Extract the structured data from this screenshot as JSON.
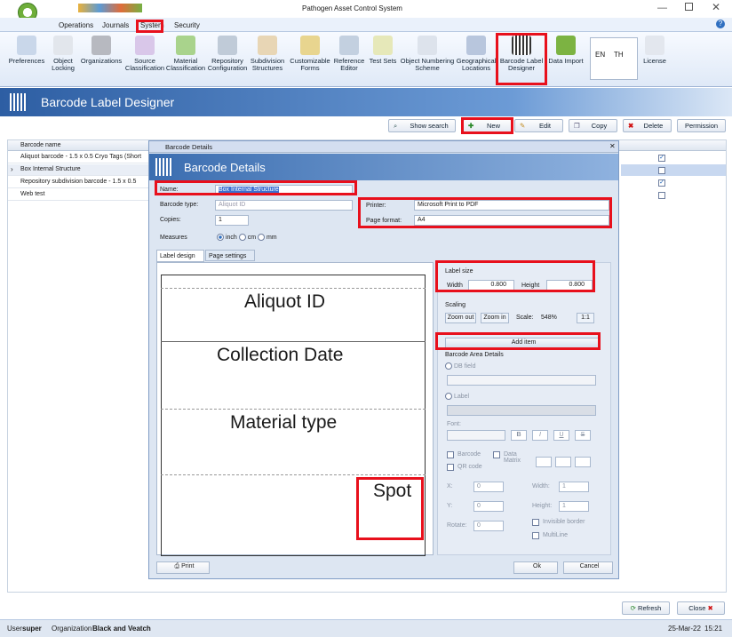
{
  "app": {
    "title": "Pathogen Asset Control System",
    "help": "?"
  },
  "ribbon_tabs": [
    "Operations",
    "Journals",
    "System",
    "Security"
  ],
  "ribbon": [
    {
      "l1": "Preferences",
      "l2": ""
    },
    {
      "l1": "Object",
      "l2": "Locking"
    },
    {
      "l1": "Organizations",
      "l2": ""
    },
    {
      "l1": "Source",
      "l2": "Classification"
    },
    {
      "l1": "Material",
      "l2": "Classification"
    },
    {
      "l1": "Repository",
      "l2": "Configuration"
    },
    {
      "l1": "Subdivision",
      "l2": "Structures"
    },
    {
      "l1": "Customizable",
      "l2": "Forms"
    },
    {
      "l1": "Reference",
      "l2": "Editor"
    },
    {
      "l1": "Test Sets",
      "l2": ""
    },
    {
      "l1": "Object Numbering",
      "l2": "Scheme"
    },
    {
      "l1": "Geographical",
      "l2": "Locations"
    },
    {
      "l1": "Barcode Label",
      "l2": "Designer"
    },
    {
      "l1": "Data Import",
      "l2": ""
    }
  ],
  "lang": {
    "en": "EN",
    "th": "TH"
  },
  "license": "License",
  "header": {
    "title": "Barcode Label Designer"
  },
  "toolbar": {
    "search": "Show search",
    "new": "New",
    "edit": "Edit",
    "copy": "Copy",
    "delete": "Delete",
    "permission": "Permission"
  },
  "list": {
    "header": "Barcode name",
    "rows": [
      {
        "name": "Aliquot barcode - 1.5 x 0.5 Cryo Tags (Short",
        "checked": true
      },
      {
        "name": "Box Internal Structure",
        "checked": false
      },
      {
        "name": "Repository subdivision barcode - 1.5 x 0.5",
        "checked": true
      },
      {
        "name": "Web test",
        "checked": false
      }
    ]
  },
  "dialog": {
    "window_title": "Barcode Details",
    "title": "Barcode Details",
    "name_label": "Name:",
    "name_value": "Box Internal Structure",
    "type_label": "Barcode type:",
    "type_value": "Aliquot ID",
    "copies_label": "Copies:",
    "copies_value": "1",
    "measures_label": "Measures",
    "units": [
      "inch",
      "cm",
      "mm"
    ],
    "printer_label": "Printer:",
    "printer_value": "Microsoft Print to PDF",
    "page_label": "Page format:",
    "page_value": "A4",
    "tabs": [
      "Label design",
      "Page settings"
    ],
    "canvas_items": [
      "Aliquot ID",
      "Collection Date",
      "Material type",
      "Spot"
    ],
    "label_size": {
      "title": "Label size",
      "width_label": "Width",
      "width": "0.800",
      "height_label": "Height",
      "height": "0.800"
    },
    "scaling": {
      "title": "Scaling",
      "zoom_out": "Zoom out",
      "zoom_in": "Zoom in",
      "scale_label": "Scale:",
      "scale": "548%",
      "one": "1:1"
    },
    "add_item": "Add item",
    "area": {
      "title": "Barcode Area Details",
      "db_field": "DB field",
      "label": "Label",
      "font": "Font:",
      "barcode": "Barcode",
      "data_matrix": "Data Matrix",
      "qr": "QR code",
      "x": "X:",
      "y": "Y:",
      "rotate": "Rotate:",
      "width": "Width:",
      "height": "Height:",
      "xv": "0",
      "yv": "0",
      "rv": "0",
      "wv": "1",
      "hv": "1",
      "invisible": "Invisible border",
      "multiline": "MultiLine"
    },
    "print": "Print",
    "ok": "Ok",
    "cancel": "Cancel"
  },
  "footer": {
    "refresh": "Refresh",
    "close": "Close"
  },
  "status": {
    "user_label": "User",
    "user": "super",
    "org_label": "Organization",
    "org": "Black and Veatch",
    "date": "25-Mar-22",
    "time": "15:21"
  }
}
